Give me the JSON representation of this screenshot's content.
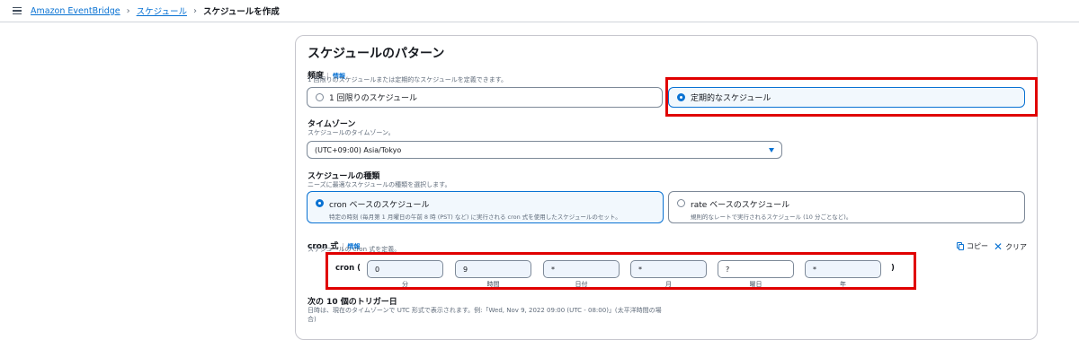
{
  "breadcrumb": {
    "items": [
      "Amazon EventBridge",
      "スケジュール"
    ],
    "current": "スケジュールを作成",
    "separator": "›"
  },
  "panel": {
    "title": "スケジュールのパターン",
    "frequency": {
      "label": "頻度",
      "info": "情報",
      "description": "1 回限りのスケジュールまたは定期的なスケジュールを定義できます。",
      "options": [
        {
          "label": "1 回限りのスケジュール",
          "selected": false
        },
        {
          "label": "定期的なスケジュール",
          "selected": true
        }
      ]
    },
    "timezone": {
      "label": "タイムゾーン",
      "description": "スケジュールのタイムゾーン。",
      "value": "(UTC+09:00) Asia/Tokyo"
    },
    "schedule_type": {
      "label": "スケジュールの種類",
      "description": "ニーズに最適なスケジュールの種類を選択します。",
      "options": [
        {
          "label": "cron ベースのスケジュール",
          "sub": "特定の時刻 (毎月第 1 月曜日の午前 8 時 (PST) など) に実行される cron 式を使用したスケジュールのセット。",
          "selected": true
        },
        {
          "label": "rate ベースのスケジュール",
          "sub": "規則的なレートで実行されるスケジュール (10 分ごとなど)。",
          "selected": false
        }
      ]
    },
    "cron": {
      "label": "cron 式",
      "info": "情報",
      "description": "スケジュールの cron 式を定義。",
      "copy_label": "コピー",
      "clear_label": "クリア",
      "prefix": "cron (",
      "suffix": ")",
      "fields": [
        {
          "value": "0",
          "caption": "分"
        },
        {
          "value": "9",
          "caption": "時間"
        },
        {
          "value": "*",
          "caption": "日付"
        },
        {
          "value": "*",
          "caption": "月"
        },
        {
          "value": "?",
          "caption": "曜日"
        },
        {
          "value": "*",
          "caption": "年"
        }
      ]
    },
    "next_triggers": {
      "label": "次の 10 個のトリガー日",
      "description": "日時は、現在のタイムゾーンで UTC 形式で表示されます。例:「Wed, Nov 9, 2022 09:00 (UTC - 08:00)」(太平洋時間の場合)"
    }
  },
  "colors": {
    "accent": "#0972d3",
    "highlight": "#e00000",
    "selected_bg": "#f2f8fd",
    "input_bg": "#eef4fc"
  }
}
